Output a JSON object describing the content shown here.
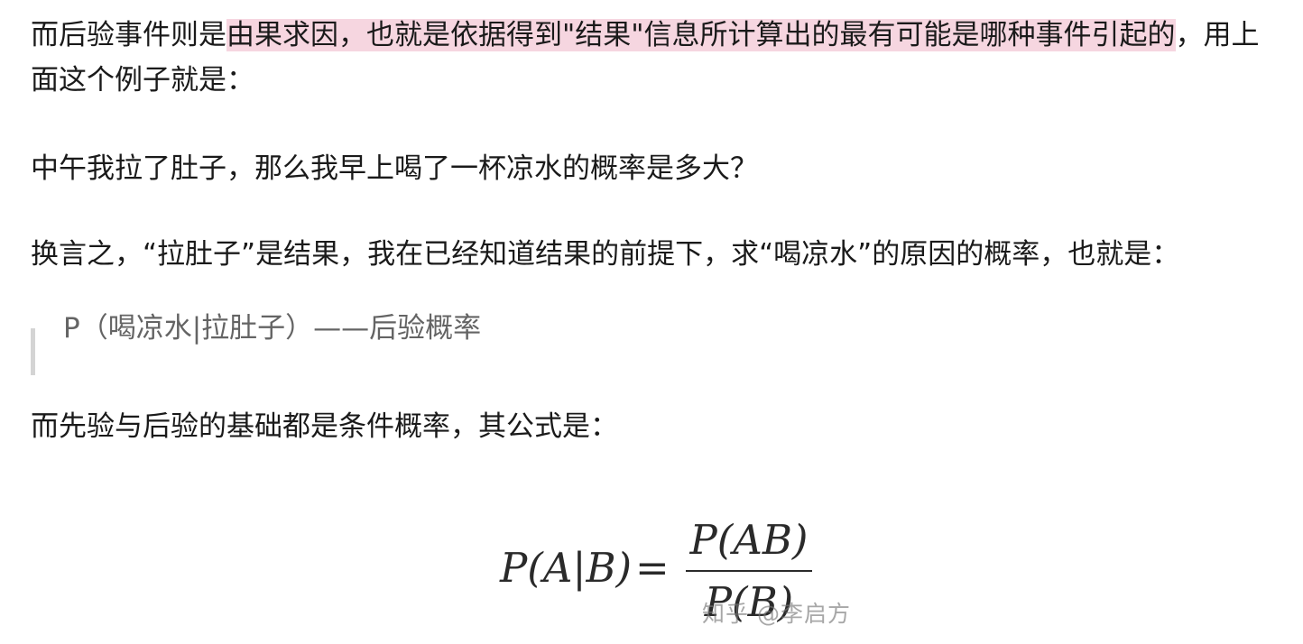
{
  "paragraph1": {
    "before": "而后验事件则是",
    "highlight": "由果求因，也就是依据得到\"结果\"信息所计算出的最有可能是哪种事件引起的",
    "after": "，用上面这个例子就是："
  },
  "paragraph2": "中午我拉了肚子，那么我早上喝了一杯凉水的概率是多大？",
  "paragraph3": "换言之，“拉肚子”是结果，我在已经知道结果的前提下，求“喝凉水”的原因的概率，也就是：",
  "blockquote": "P（喝凉水|拉肚子）——后验概率",
  "paragraph4": "而先验与后验的基础都是条件概率，其公式是：",
  "formula": {
    "lhs": "P(A|B)",
    "equals": "=",
    "numerator": "P(AB)",
    "denominator": "P(B)"
  },
  "watermark": "知乎 @李启方"
}
